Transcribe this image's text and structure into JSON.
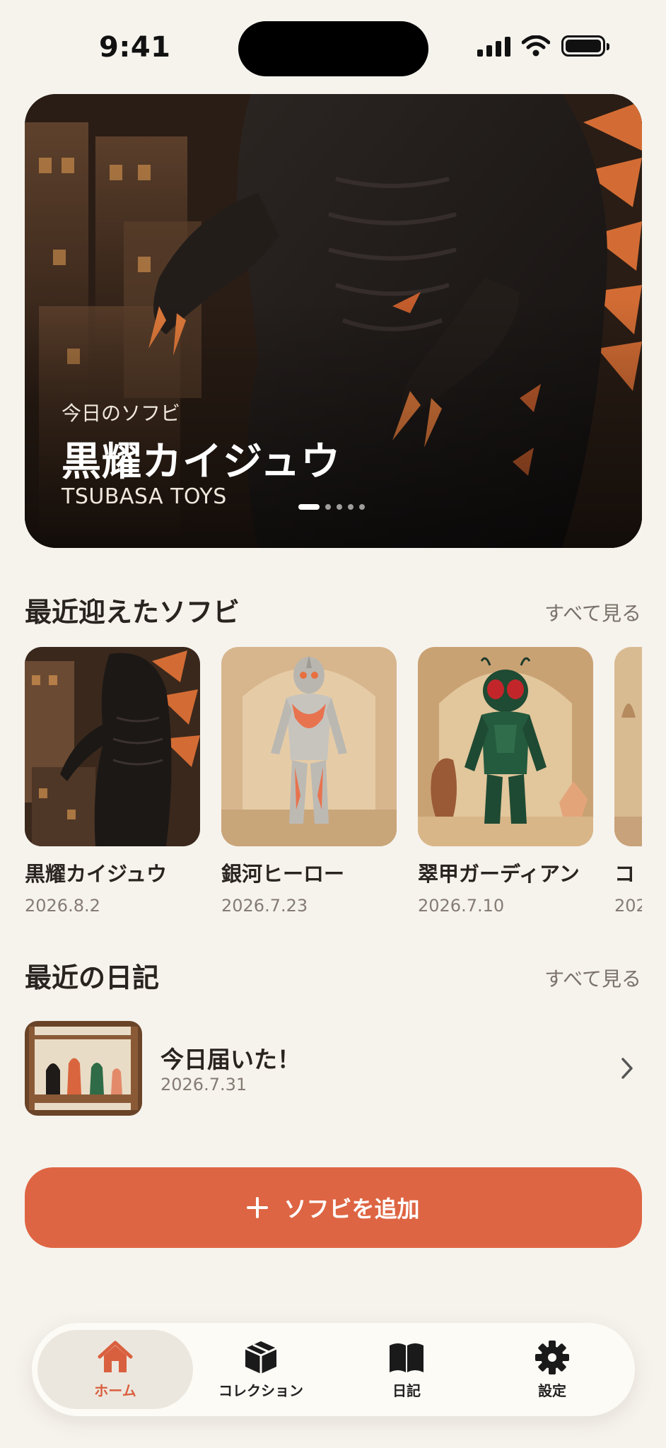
{
  "status_bar": {
    "time": "9:41"
  },
  "hero": {
    "subtitle": "今日のソフビ",
    "title": "黒耀カイジュウ",
    "maker": "TSUBASA TOYS",
    "page_count": 5,
    "active_page": 1
  },
  "recent": {
    "title": "最近迎えたソフビ",
    "see_all": "すべて見る",
    "items": [
      {
        "name": "黒耀カイジュウ",
        "date": "2026.8.2",
        "icon": "kaiju-figure"
      },
      {
        "name": "銀河ヒーロー",
        "date": "2026.7.23",
        "icon": "hero-figure"
      },
      {
        "name": "翠甲ガーディアン",
        "date": "2026.7.10",
        "icon": "insect-guardian-figure"
      },
      {
        "name": "コ",
        "date": "202",
        "icon": "partial-figure"
      }
    ]
  },
  "diary": {
    "title": "最近の日記",
    "see_all": "すべて見る",
    "entry": {
      "title": "今日届いた！",
      "date": "2026.7.31"
    }
  },
  "add_button": {
    "label": "ソフビを追加"
  },
  "tabs": [
    {
      "label": "ホーム",
      "icon": "home-icon",
      "active": true
    },
    {
      "label": "コレクション",
      "icon": "box-icon",
      "active": false
    },
    {
      "label": "日記",
      "icon": "book-icon",
      "active": false
    },
    {
      "label": "設定",
      "icon": "gear-icon",
      "active": false
    }
  ],
  "colors": {
    "accent": "#de6543",
    "background": "#f6f3ed",
    "tab_active_bg": "#ece7de"
  }
}
